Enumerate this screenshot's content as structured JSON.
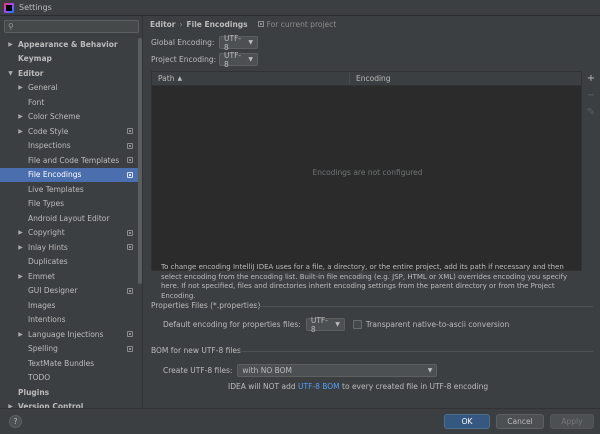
{
  "window": {
    "title": "Settings"
  },
  "sidebar": {
    "search_placeholder": "",
    "items": [
      {
        "label": "Appearance & Behavior",
        "level": 0,
        "arrow": "▶",
        "bold": true,
        "proj": false,
        "selected": false
      },
      {
        "label": "Keymap",
        "level": 0,
        "arrow": "",
        "bold": true,
        "proj": false,
        "selected": false
      },
      {
        "label": "Editor",
        "level": 0,
        "arrow": "▼",
        "bold": true,
        "proj": false,
        "selected": false
      },
      {
        "label": "General",
        "level": 1,
        "arrow": "▶",
        "bold": false,
        "proj": false,
        "selected": false
      },
      {
        "label": "Font",
        "level": 1,
        "arrow": "",
        "bold": false,
        "proj": false,
        "selected": false
      },
      {
        "label": "Color Scheme",
        "level": 1,
        "arrow": "▶",
        "bold": false,
        "proj": false,
        "selected": false
      },
      {
        "label": "Code Style",
        "level": 1,
        "arrow": "▶",
        "bold": false,
        "proj": true,
        "selected": false
      },
      {
        "label": "Inspections",
        "level": 1,
        "arrow": "",
        "bold": false,
        "proj": true,
        "selected": false
      },
      {
        "label": "File and Code Templates",
        "level": 1,
        "arrow": "",
        "bold": false,
        "proj": true,
        "selected": false
      },
      {
        "label": "File Encodings",
        "level": 1,
        "arrow": "",
        "bold": false,
        "proj": true,
        "selected": true
      },
      {
        "label": "Live Templates",
        "level": 1,
        "arrow": "",
        "bold": false,
        "proj": false,
        "selected": false
      },
      {
        "label": "File Types",
        "level": 1,
        "arrow": "",
        "bold": false,
        "proj": false,
        "selected": false
      },
      {
        "label": "Android Layout Editor",
        "level": 1,
        "arrow": "",
        "bold": false,
        "proj": false,
        "selected": false
      },
      {
        "label": "Copyright",
        "level": 1,
        "arrow": "▶",
        "bold": false,
        "proj": true,
        "selected": false
      },
      {
        "label": "Inlay Hints",
        "level": 1,
        "arrow": "▶",
        "bold": false,
        "proj": true,
        "selected": false
      },
      {
        "label": "Duplicates",
        "level": 1,
        "arrow": "",
        "bold": false,
        "proj": false,
        "selected": false
      },
      {
        "label": "Emmet",
        "level": 1,
        "arrow": "▶",
        "bold": false,
        "proj": false,
        "selected": false
      },
      {
        "label": "GUI Designer",
        "level": 1,
        "arrow": "",
        "bold": false,
        "proj": true,
        "selected": false
      },
      {
        "label": "Images",
        "level": 1,
        "arrow": "",
        "bold": false,
        "proj": false,
        "selected": false
      },
      {
        "label": "Intentions",
        "level": 1,
        "arrow": "",
        "bold": false,
        "proj": false,
        "selected": false
      },
      {
        "label": "Language Injections",
        "level": 1,
        "arrow": "▶",
        "bold": false,
        "proj": true,
        "selected": false
      },
      {
        "label": "Spelling",
        "level": 1,
        "arrow": "",
        "bold": false,
        "proj": true,
        "selected": false
      },
      {
        "label": "TextMate Bundles",
        "level": 1,
        "arrow": "",
        "bold": false,
        "proj": false,
        "selected": false
      },
      {
        "label": "TODO",
        "level": 1,
        "arrow": "",
        "bold": false,
        "proj": false,
        "selected": false
      },
      {
        "label": "Plugins",
        "level": 0,
        "arrow": "",
        "bold": true,
        "proj": false,
        "selected": false
      },
      {
        "label": "Version Control",
        "level": 0,
        "arrow": "▶",
        "bold": true,
        "proj": false,
        "selected": false
      }
    ]
  },
  "breadcrumb": {
    "parent": "Editor",
    "separator": "›",
    "current": "File Encodings",
    "note": "For current project"
  },
  "global_encoding": {
    "label": "Global Encoding:",
    "value": "UTF-8"
  },
  "project_encoding": {
    "label": "Project Encoding:",
    "value": "UTF-8"
  },
  "table": {
    "columns": [
      "Path",
      "Encoding"
    ],
    "empty_text": "Encodings are not configured",
    "tools": [
      "+",
      "−",
      "✎"
    ]
  },
  "description": "To change encoding IntelliJ IDEA uses for a file, a directory, or the entire project, add its path if necessary and then select encoding from the encoding list. Built-in file encoding (e.g. JSP, HTML or XML) overrides encoding you specify here. If not specified, files and directories inherit encoding settings from the parent directory or from the Project Encoding.",
  "properties": {
    "section_title": "Properties Files (*.properties)",
    "default_label": "Default encoding for properties files:",
    "default_value": "UTF-8",
    "transparent_label": "Transparent native-to-ascii conversion",
    "transparent_checked": false
  },
  "bom": {
    "section_title": "BOM for new UTF-8 files",
    "create_label": "Create UTF-8 files:",
    "create_value": "with NO BOM",
    "hint_prefix": "IDEA will NOT add ",
    "hint_link": "UTF-8 BOM",
    "hint_suffix": " to every created file in UTF-8 encoding"
  },
  "buttons": {
    "help": "?",
    "ok": "OK",
    "cancel": "Cancel",
    "apply": "Apply"
  }
}
